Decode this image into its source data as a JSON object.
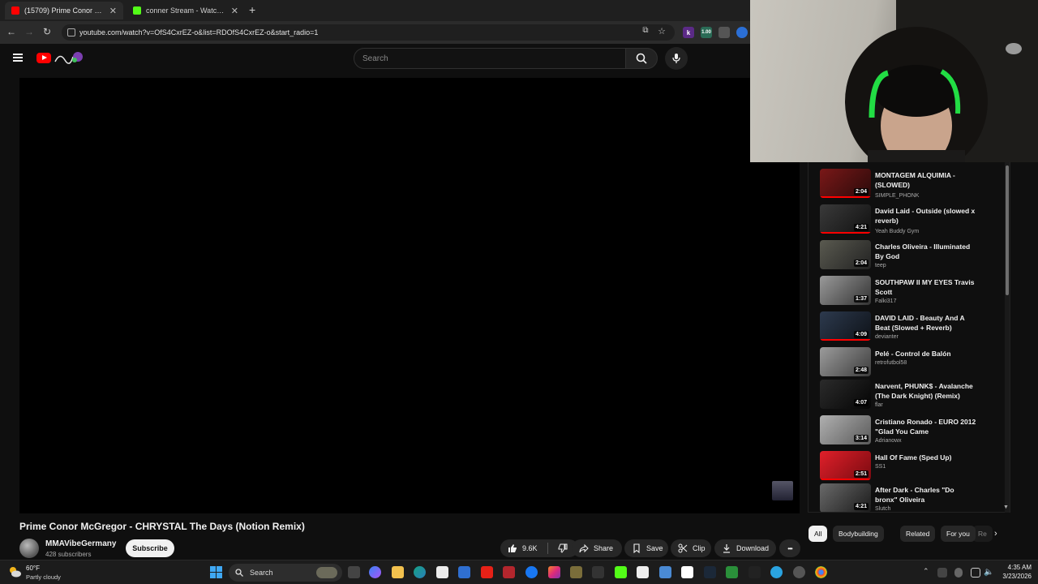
{
  "browser": {
    "tabs": [
      {
        "title": "(15709) Prime Conor McGregor",
        "color": "#ff0000"
      },
      {
        "title": "conner Stream - Watch Live on",
        "color": "#53fc18"
      }
    ],
    "url": "youtube.com/watch?v=OfS4CxrEZ-o&list=RDOfS4CxrEZ-o&start_radio=1",
    "new_tab": "+",
    "extension_k": "k",
    "extension_speed": "1.00"
  },
  "youtube": {
    "search_placeholder": "Search",
    "video_title": "Prime Conor McGregor - CHRYSTAL The Days (Notion Remix)",
    "channel_name": "MMAVibeGermany",
    "subscribers": "428 subscribers",
    "subscribe_label": "Subscribe",
    "actions": {
      "likes": "9.6K",
      "share": "Share",
      "save": "Save",
      "clip": "Clip",
      "download": "Download",
      "more": "•••"
    }
  },
  "sidebar": {
    "items": [
      {
        "title": "MONTAGEM ALQUIMIA - (SLOWED)",
        "channel": "SIMPLE_PHONK",
        "duration": "2:04",
        "thumb": "#5a1010",
        "progress": 1.0
      },
      {
        "title": "David Laid - Outside (slowed x reverb)",
        "channel": "Yeah Buddy Gym",
        "duration": "4:21",
        "thumb": "#2a2a2a",
        "progress": 1.0
      },
      {
        "title": "Charles Oliveira - Illuminated By God",
        "channel": "teep",
        "duration": "2:04",
        "thumb": "#3b3b36",
        "progress": 0
      },
      {
        "title": "SOUTHPAW II MY EYES Travis Scott",
        "channel": "Falki317",
        "duration": "1:37",
        "thumb": "#6a6a6a",
        "progress": 0
      },
      {
        "title": "DAVID LAID - Beauty And A Beat (Slowed + Reverb)",
        "channel": "devianter",
        "duration": "4:09",
        "thumb": "#263040",
        "progress": 1.0
      },
      {
        "title": "Pelé - Control de Balón",
        "channel": "retrofutbol58",
        "duration": "2:48",
        "thumb": "#707070",
        "progress": 0
      },
      {
        "title": "Narvent, PHUNK$ - Avalanche (The Dark Knight) (Remix)",
        "channel": "flar",
        "duration": "4:07",
        "thumb": "#1e1e1e",
        "progress": 0
      },
      {
        "title": "Cristiano Ronado - EURO 2012 \"Glad You Came",
        "channel": "Adrianowx",
        "duration": "3:14",
        "thumb": "#8a8a8a",
        "progress": 0
      },
      {
        "title": "Hall Of Fame (Sped Up)",
        "channel": "SS1",
        "duration": "2:51",
        "thumb": "#c0141e",
        "progress": 1.0
      },
      {
        "title": "After Dark - Charles \"Do bronx\" Oliveira",
        "channel": "Slutch",
        "duration": "4:21",
        "thumb": "#4a4a4a",
        "progress": 0
      }
    ],
    "chips": [
      "All",
      "Bodybuilding",
      "Related",
      "For you",
      "Re"
    ]
  },
  "taskbar": {
    "temperature": "60°F",
    "condition": "Partly cloudy",
    "search_label": "Search",
    "time": "4:35 AM",
    "date": "3/23/2026"
  },
  "colors": {
    "accent": "#ff0000",
    "background": "#0f0f0f",
    "chip_bg": "#272727"
  }
}
